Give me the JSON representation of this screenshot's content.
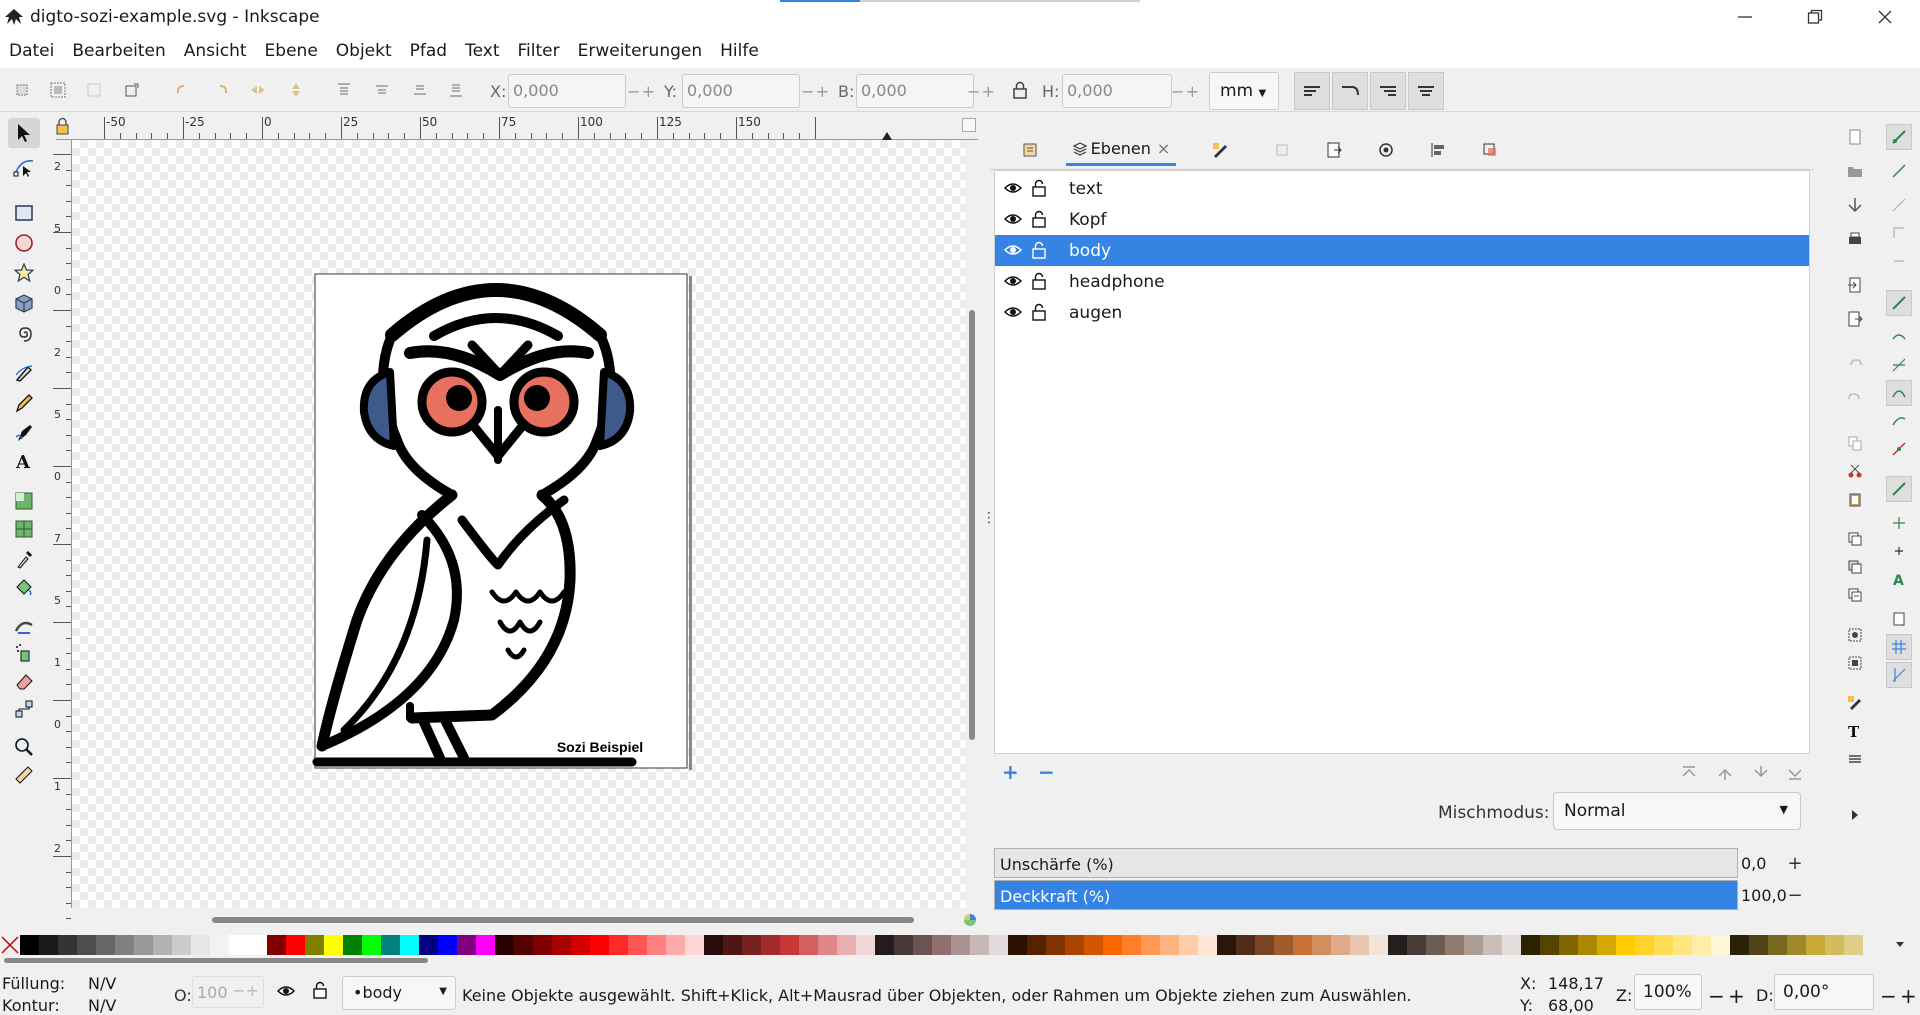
{
  "window": {
    "title": "digto-sozi-example.svg - Inkscape",
    "minimize_icon": "minimize-icon",
    "maximize_icon": "restore-icon",
    "close_icon": "close-icon"
  },
  "menu": [
    "Datei",
    "Bearbeiten",
    "Ansicht",
    "Ebene",
    "Objekt",
    "Pfad",
    "Text",
    "Filter",
    "Erweiterungen",
    "Hilfe"
  ],
  "tool_controls": {
    "x_label": "X:",
    "x_value": "0,000",
    "y_label": "Y:",
    "y_value": "0,000",
    "b_label": "B:",
    "b_value": "0,000",
    "h_label": "H:",
    "h_value": "0,000",
    "unit": "mm"
  },
  "ruler": {
    "top_ticks": [
      "-50",
      "-25",
      "0",
      "25",
      "50",
      "75",
      "100",
      "125",
      "150"
    ],
    "left_ticks": [
      "2",
      "5",
      "0",
      "2",
      "5",
      "0",
      "7",
      "5",
      "1",
      "0",
      "1",
      "2"
    ]
  },
  "canvas": {
    "page_text": "Sozi Beispiel",
    "colors": {
      "eye_fill": "#e8705f",
      "headphone_fill": "#3e5a8c",
      "stroke": "#000000"
    }
  },
  "layers_panel": {
    "active_tab": "Ebenen",
    "tab_close": "×",
    "layers": [
      {
        "name": "text",
        "selected": false
      },
      {
        "name": "Kopf",
        "selected": false
      },
      {
        "name": "body",
        "selected": true
      },
      {
        "name": "headphone",
        "selected": false
      },
      {
        "name": "augen",
        "selected": false
      }
    ],
    "add": "+",
    "remove": "−",
    "blend_label": "Mischmodus:",
    "blend_value": "Normal",
    "blur_label": "Unschärfe (%)",
    "blur_value": "0,0",
    "opacity_label": "Deckkraft (%)",
    "opacity_value": "100,0",
    "opacity_percent": 100,
    "accent": "#3584e4"
  },
  "palette": [
    "#000000",
    "#1a1a1a",
    "#333333",
    "#4d4d4d",
    "#666666",
    "#808080",
    "#999999",
    "#b3b3b3",
    "#cccccc",
    "#e6e6e6",
    "#f2f2f2",
    "#ffffff",
    "#ffffff",
    "#800000",
    "#ff0000",
    "#808000",
    "#ffff00",
    "#008000",
    "#00ff00",
    "#008080",
    "#00ffff",
    "#000080",
    "#0000ff",
    "#800080",
    "#ff00ff",
    "#2b0000",
    "#550000",
    "#800000",
    "#aa0000",
    "#d40000",
    "#ff0000",
    "#ff2a2a",
    "#ff5555",
    "#ff8080",
    "#ffaaaa",
    "#ffd5d5",
    "#280b0b",
    "#501616",
    "#782121",
    "#a02c2c",
    "#c83737",
    "#d35f5f",
    "#de8787",
    "#e9afaf",
    "#f4d7d7",
    "#241c1c",
    "#483737",
    "#6c5353",
    "#916f6f",
    "#ac9393",
    "#c8b7b7",
    "#e3dbdb",
    "#2b1100",
    "#552200",
    "#803300",
    "#aa4400",
    "#d45500",
    "#ff6600",
    "#ff7f2a",
    "#ff9955",
    "#ffb380",
    "#ffccaa",
    "#ffe6d5",
    "#28170b",
    "#502d16",
    "#784421",
    "#a05a2c",
    "#c87137",
    "#d38d5f",
    "#deaa87",
    "#e9c6af",
    "#f4e3d7",
    "#241f1c",
    "#483e37",
    "#6c5d53",
    "#917c6f",
    "#ac9d93",
    "#c8beb7",
    "#e3dedb",
    "#2b2200",
    "#554400",
    "#806600",
    "#aa8800",
    "#d4aa00",
    "#ffcc00",
    "#ffd42a",
    "#ffdd55",
    "#ffe680",
    "#ffeeaa",
    "#fff6d5",
    "#28220b",
    "#504416",
    "#786721",
    "#a0892c",
    "#c8ab37",
    "#d3bc5f",
    "#decd87"
  ],
  "status": {
    "fill_label": "Füllung:",
    "fill_value": "N/V",
    "stroke_label": "Kontur:",
    "stroke_value": "N/V",
    "opacity_label": "O:",
    "opacity_value": "100",
    "layer": "•body",
    "message": "Keine Objekte ausgewählt. Shift+Klick, Alt+Mausrad über Objekten, oder Rahmen um Objekte ziehen zum Auswählen.",
    "x_label": "X:",
    "x_value": "148,17",
    "y_label": "Y:",
    "y_value": "68,00",
    "zoom_label": "Z:",
    "zoom_value": "100%",
    "rot_label": "D:",
    "rot_value": "0,00°"
  }
}
